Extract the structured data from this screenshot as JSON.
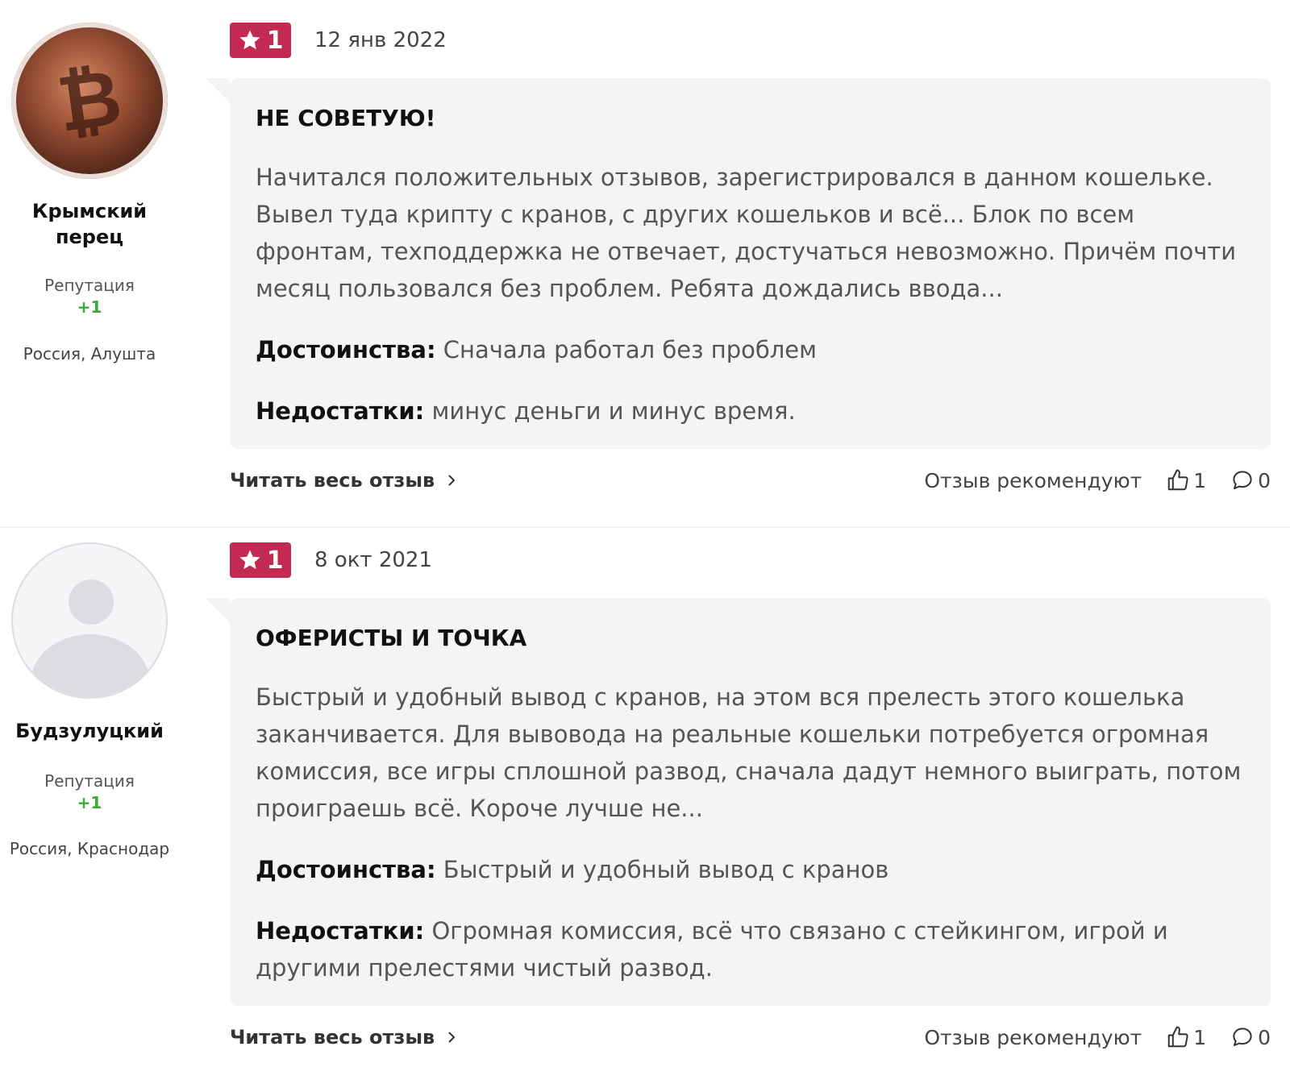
{
  "reviews": [
    {
      "author": {
        "name": "Крымский перец",
        "reputation_label": "Репутация",
        "reputation_value": "+1",
        "location": "Россия, Алушта",
        "avatar_icon": "bitcoin-coin-photo"
      },
      "rating": "1",
      "date": "12 янв 2022",
      "title": "НЕ СОВЕТУЮ!",
      "text": "Начитался положительных отзывов, зарегистрировался в данном кошельке. Вывел туда крипту с кранов, с других кошельков и всё... Блок по всем фронтам, техподдержка не отвечает, достучаться невозможно. Причём почти месяц пользовался без проблем. Ребята дождались ввода...",
      "pros_label": "Достоинства:",
      "pros": "Сначала работал без проблем",
      "cons_label": "Недостатки:",
      "cons": "минус деньги и минус время.",
      "read_more": "Читать весь отзыв",
      "recommend_label": "Отзыв рекомендуют",
      "likes": "1",
      "comments": "0"
    },
    {
      "author": {
        "name": "Будзулуцкий",
        "reputation_label": "Репутация",
        "reputation_value": "+1",
        "location": "Россия, Краснодар",
        "avatar_icon": "default-user-avatar"
      },
      "rating": "1",
      "date": "8 окт 2021",
      "title": "ОФЕРИСТЫ И ТОЧКА",
      "text": "Быстрый и удобный вывод с кранов, на этом вся прелесть этого кошелька заканчивается. Для вывовода на реальные кошельки потребуется огромная комиссия, все игры сплошной развод, сначала дадут немного выиграть, потом проиграешь всё. Короче лучше не...",
      "pros_label": "Достоинства:",
      "pros": "Быстрый и удобный вывод с кранов",
      "cons_label": "Недостатки:",
      "cons": "Огромная комиссия, всё что связано с стейкингом, игрой и другими прелестями чистый развод.",
      "read_more": "Читать весь отзыв",
      "recommend_label": "Отзыв рекомендуют",
      "likes": "1",
      "comments": "0"
    }
  ],
  "colors": {
    "rating_badge": "#c32a51",
    "reputation_positive": "#3aaa35",
    "bubble_bg": "#f4f4f6"
  }
}
